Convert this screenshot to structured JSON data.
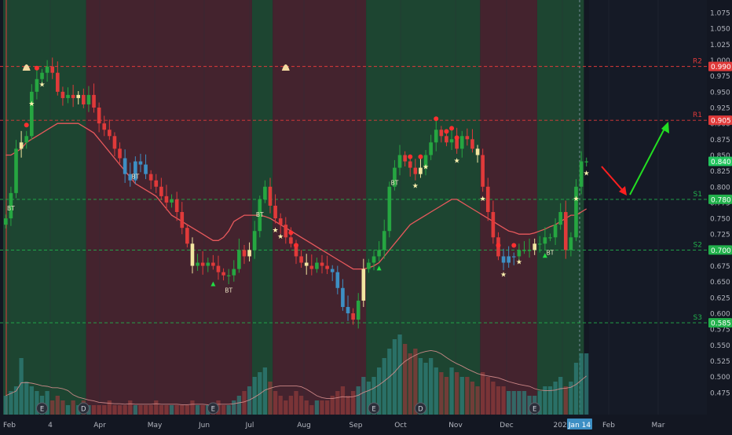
{
  "colors": {
    "background": "#131722",
    "bull_zone": "#1f4a33",
    "bear_zone": "#4a2530",
    "up_candle": "#26a641",
    "down_candle": "#e03a3a",
    "pale_candle": "#f2e6a0",
    "blue_candle": "#3d8fc4",
    "ma_line": "#e8595c",
    "volume_ma": "#d88f8f",
    "r_level": "#e03a3a",
    "s_level": "#22b14c",
    "axis_text": "#b2b5be",
    "arrow_down": "#ff1f1f",
    "arrow_up": "#22dd22"
  },
  "chart_data": {
    "type": "candlestick",
    "price_axis": {
      "min": 0.44,
      "max": 1.09,
      "ticks": [
        "1.075",
        "1.050",
        "1.025",
        "1.000",
        "0.975",
        "0.950",
        "0.925",
        "0.900",
        "0.875",
        "0.850",
        "0.825",
        "0.800",
        "0.775",
        "0.750",
        "0.725",
        "0.700",
        "0.675",
        "0.650",
        "0.625",
        "0.600",
        "0.575",
        "0.550",
        "0.525",
        "0.500",
        "0.475"
      ]
    },
    "time_axis": {
      "labels": [
        "Feb",
        "4",
        "Apr",
        "May",
        "Jun",
        "Jul",
        "Aug",
        "Sep",
        "Oct",
        "Nov",
        "Dec",
        "2020",
        "Feb",
        "Mar"
      ],
      "highlighted_label": "Jan 14"
    },
    "levels": [
      {
        "name": "R2",
        "value": 0.99,
        "label": "0.990",
        "kind": "resistance"
      },
      {
        "name": "R1",
        "value": 0.905,
        "label": "0.905",
        "kind": "resistance"
      },
      {
        "name": "S1",
        "value": 0.78,
        "label": "0.780",
        "kind": "support"
      },
      {
        "name": "S2",
        "value": 0.7,
        "label": "0.700",
        "kind": "support"
      },
      {
        "name": "S3",
        "value": 0.585,
        "label": "0.585",
        "kind": "support"
      }
    ],
    "last_price": {
      "value": 0.84,
      "label": "0.840"
    },
    "zones": [
      {
        "kind": "bull",
        "start": 0,
        "end": 16
      },
      {
        "kind": "bear",
        "start": 16,
        "end": 48
      },
      {
        "kind": "bull",
        "start": 48,
        "end": 52
      },
      {
        "kind": "bear",
        "start": 52,
        "end": 70
      },
      {
        "kind": "bull",
        "start": 70,
        "end": 92
      },
      {
        "kind": "bear",
        "start": 92,
        "end": 103
      },
      {
        "kind": "bull",
        "start": 103,
        "end": 112
      }
    ],
    "closes": [
      0.75,
      0.79,
      0.86,
      0.87,
      0.88,
      0.95,
      0.97,
      0.98,
      0.99,
      0.98,
      0.95,
      0.94,
      0.945,
      0.94,
      0.945,
      0.93,
      0.945,
      0.925,
      0.9,
      0.89,
      0.88,
      0.86,
      0.845,
      0.82,
      0.81,
      0.84,
      0.835,
      0.82,
      0.81,
      0.8,
      0.785,
      0.775,
      0.78,
      0.76,
      0.735,
      0.71,
      0.675,
      0.68,
      0.675,
      0.68,
      0.675,
      0.665,
      0.66,
      0.66,
      0.67,
      0.7,
      0.69,
      0.7,
      0.73,
      0.78,
      0.8,
      0.77,
      0.75,
      0.74,
      0.72,
      0.71,
      0.69,
      0.68,
      0.675,
      0.67,
      0.68,
      0.675,
      0.67,
      0.665,
      0.64,
      0.61,
      0.6,
      0.59,
      0.62,
      0.67,
      0.68,
      0.69,
      0.7,
      0.73,
      0.8,
      0.83,
      0.85,
      0.84,
      0.83,
      0.82,
      0.83,
      0.85,
      0.87,
      0.89,
      0.88,
      0.87,
      0.875,
      0.86,
      0.88,
      0.875,
      0.86,
      0.85,
      0.8,
      0.76,
      0.72,
      0.69,
      0.68,
      0.69,
      0.69,
      0.7,
      0.7,
      0.7,
      0.71,
      0.71,
      0.72,
      0.72,
      0.74,
      0.76,
      0.7,
      0.72,
      0.8,
      0.84,
      0.84
    ],
    "ma_values": [
      0.85,
      0.85,
      0.855,
      0.86,
      0.87,
      0.875,
      0.88,
      0.885,
      0.89,
      0.895,
      0.9,
      0.9,
      0.9,
      0.9,
      0.9,
      0.895,
      0.89,
      0.885,
      0.875,
      0.865,
      0.855,
      0.845,
      0.835,
      0.825,
      0.815,
      0.805,
      0.8,
      0.795,
      0.79,
      0.785,
      0.775,
      0.765,
      0.755,
      0.75,
      0.745,
      0.74,
      0.735,
      0.73,
      0.725,
      0.72,
      0.715,
      0.715,
      0.72,
      0.73,
      0.745,
      0.75,
      0.755,
      0.755,
      0.755,
      0.755,
      0.753,
      0.75,
      0.745,
      0.74,
      0.735,
      0.73,
      0.725,
      0.72,
      0.715,
      0.71,
      0.705,
      0.7,
      0.695,
      0.69,
      0.685,
      0.68,
      0.675,
      0.67,
      0.67,
      0.67,
      0.672,
      0.675,
      0.68,
      0.69,
      0.7,
      0.71,
      0.72,
      0.73,
      0.74,
      0.745,
      0.75,
      0.755,
      0.76,
      0.765,
      0.77,
      0.775,
      0.78,
      0.78,
      0.775,
      0.77,
      0.765,
      0.76,
      0.755,
      0.75,
      0.745,
      0.74,
      0.735,
      0.73,
      0.728,
      0.725,
      0.725,
      0.725,
      0.727,
      0.73,
      0.733,
      0.737,
      0.74,
      0.745,
      0.75,
      0.755,
      0.755,
      0.76,
      0.765
    ],
    "volumes": [
      0.04,
      0.05,
      0.06,
      0.12,
      0.07,
      0.06,
      0.05,
      0.04,
      0.05,
      0.03,
      0.04,
      0.03,
      0.02,
      0.03,
      0.02,
      0.03,
      0.02,
      0.02,
      0.02,
      0.02,
      0.03,
      0.02,
      0.02,
      0.02,
      0.03,
      0.02,
      0.02,
      0.02,
      0.02,
      0.03,
      0.02,
      0.02,
      0.02,
      0.02,
      0.02,
      0.02,
      0.03,
      0.02,
      0.02,
      0.02,
      0.02,
      0.03,
      0.02,
      0.02,
      0.03,
      0.04,
      0.05,
      0.06,
      0.08,
      0.09,
      0.1,
      0.07,
      0.05,
      0.04,
      0.03,
      0.04,
      0.05,
      0.04,
      0.03,
      0.02,
      0.03,
      0.03,
      0.03,
      0.04,
      0.05,
      0.06,
      0.04,
      0.05,
      0.06,
      0.08,
      0.07,
      0.08,
      0.1,
      0.12,
      0.14,
      0.16,
      0.17,
      0.15,
      0.13,
      0.14,
      0.12,
      0.11,
      0.12,
      0.1,
      0.09,
      0.08,
      0.1,
      0.09,
      0.08,
      0.08,
      0.07,
      0.06,
      0.09,
      0.08,
      0.07,
      0.06,
      0.06,
      0.05,
      0.05,
      0.05,
      0.05,
      0.04,
      0.04,
      0.05,
      0.06,
      0.06,
      0.07,
      0.08,
      0.06,
      0.07,
      0.11,
      0.13,
      0.13
    ],
    "markers": [
      {
        "type": "bt",
        "index": 1
      },
      {
        "type": "star",
        "index": 5
      },
      {
        "type": "star",
        "index": 7
      },
      {
        "type": "dot",
        "index": 4
      },
      {
        "type": "dot",
        "index": 6
      },
      {
        "type": "bell",
        "index": 4
      },
      {
        "type": "bell",
        "index": 54
      },
      {
        "type": "bt",
        "index": 25
      },
      {
        "type": "tri",
        "index": 40
      },
      {
        "type": "bt",
        "index": 43
      },
      {
        "type": "bt",
        "index": 49
      },
      {
        "type": "star",
        "index": 52
      },
      {
        "type": "star",
        "index": 53
      },
      {
        "type": "dot",
        "index": 55
      },
      {
        "type": "dot",
        "index": 56
      },
      {
        "type": "bt",
        "index": 75
      },
      {
        "type": "tri",
        "index": 72
      },
      {
        "type": "dot",
        "index": 78
      },
      {
        "type": "dot",
        "index": 80
      },
      {
        "type": "star",
        "index": 79
      },
      {
        "type": "star",
        "index": 81
      },
      {
        "type": "dot",
        "index": 83
      },
      {
        "type": "dot",
        "index": 85
      },
      {
        "type": "dot",
        "index": 86
      },
      {
        "type": "dot",
        "index": 87
      },
      {
        "type": "star",
        "index": 87
      },
      {
        "type": "star",
        "index": 92
      },
      {
        "type": "dot",
        "index": 95
      },
      {
        "type": "star",
        "index": 96
      },
      {
        "type": "dot",
        "index": 98
      },
      {
        "type": "star",
        "index": 99
      },
      {
        "type": "bt",
        "index": 105
      },
      {
        "type": "tri",
        "index": 104
      },
      {
        "type": "star",
        "index": 110
      },
      {
        "type": "star",
        "index": 112
      },
      {
        "type": "dot",
        "index": 114
      },
      {
        "type": "dot",
        "index": 118
      },
      {
        "type": "star",
        "index": 119
      }
    ],
    "event_badges": [
      {
        "letter": "E",
        "index": 7
      },
      {
        "letter": "D",
        "index": 15
      },
      {
        "letter": "E",
        "index": 40
      },
      {
        "letter": "E",
        "index": 71
      },
      {
        "letter": "D",
        "index": 80
      },
      {
        "letter": "E",
        "index": 102
      }
    ],
    "forecast_arrows": [
      {
        "direction": "down"
      },
      {
        "direction": "up"
      }
    ]
  }
}
